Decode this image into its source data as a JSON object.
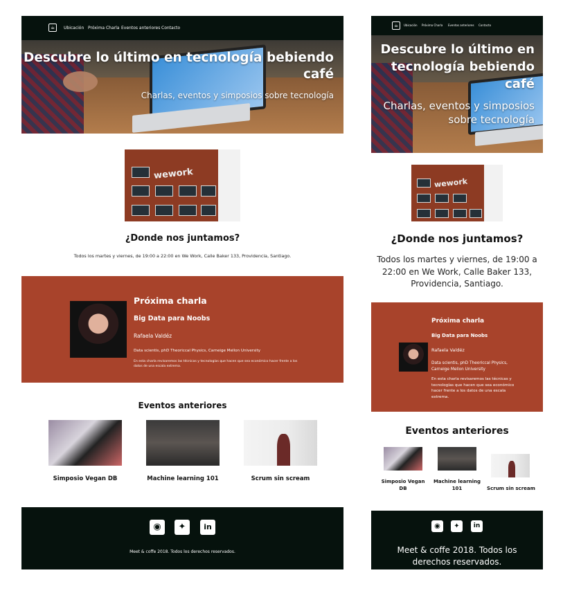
{
  "nav": {
    "logo": "",
    "links": [
      "Ubicación",
      "Próxima Charla",
      "Eventos anteriores",
      "Contacto"
    ]
  },
  "hero": {
    "title": "Descubre lo último en tecnología bebiendo café",
    "subtitle": "Charlas, eventos y simposios sobre tecnología"
  },
  "location": {
    "sign": "wework",
    "title": "¿Donde nos juntamos?",
    "text": "Todos los martes y viernes, de 19:00 a 22:00 en We Work, Calle Baker 133, Providencia, Santiago."
  },
  "next_talk": {
    "heading": "Próxima charla",
    "title": "Big Data para Noobs",
    "speaker": "Rafaela Valdéz",
    "role": "Data scientis, phD Theoriccal Physics, Carneige Mellon University",
    "description": "En esta charla revisaremos las técnicas y tecnologías que hacen que sea económico hacer frente a los datos de una escala extrema."
  },
  "events": {
    "title": "Eventos anteriores",
    "items": [
      "Simposio Vegan DB",
      "Machine learning 101",
      "Scrum sin scream"
    ]
  },
  "footer": {
    "icons": [
      "github-icon",
      "twitter-icon",
      "linkedin-icon"
    ],
    "copyright": "Meet & coffe 2018. Todos los derechos reservados."
  },
  "colors": {
    "dark": "#06120d",
    "accent": "#a8432b"
  }
}
